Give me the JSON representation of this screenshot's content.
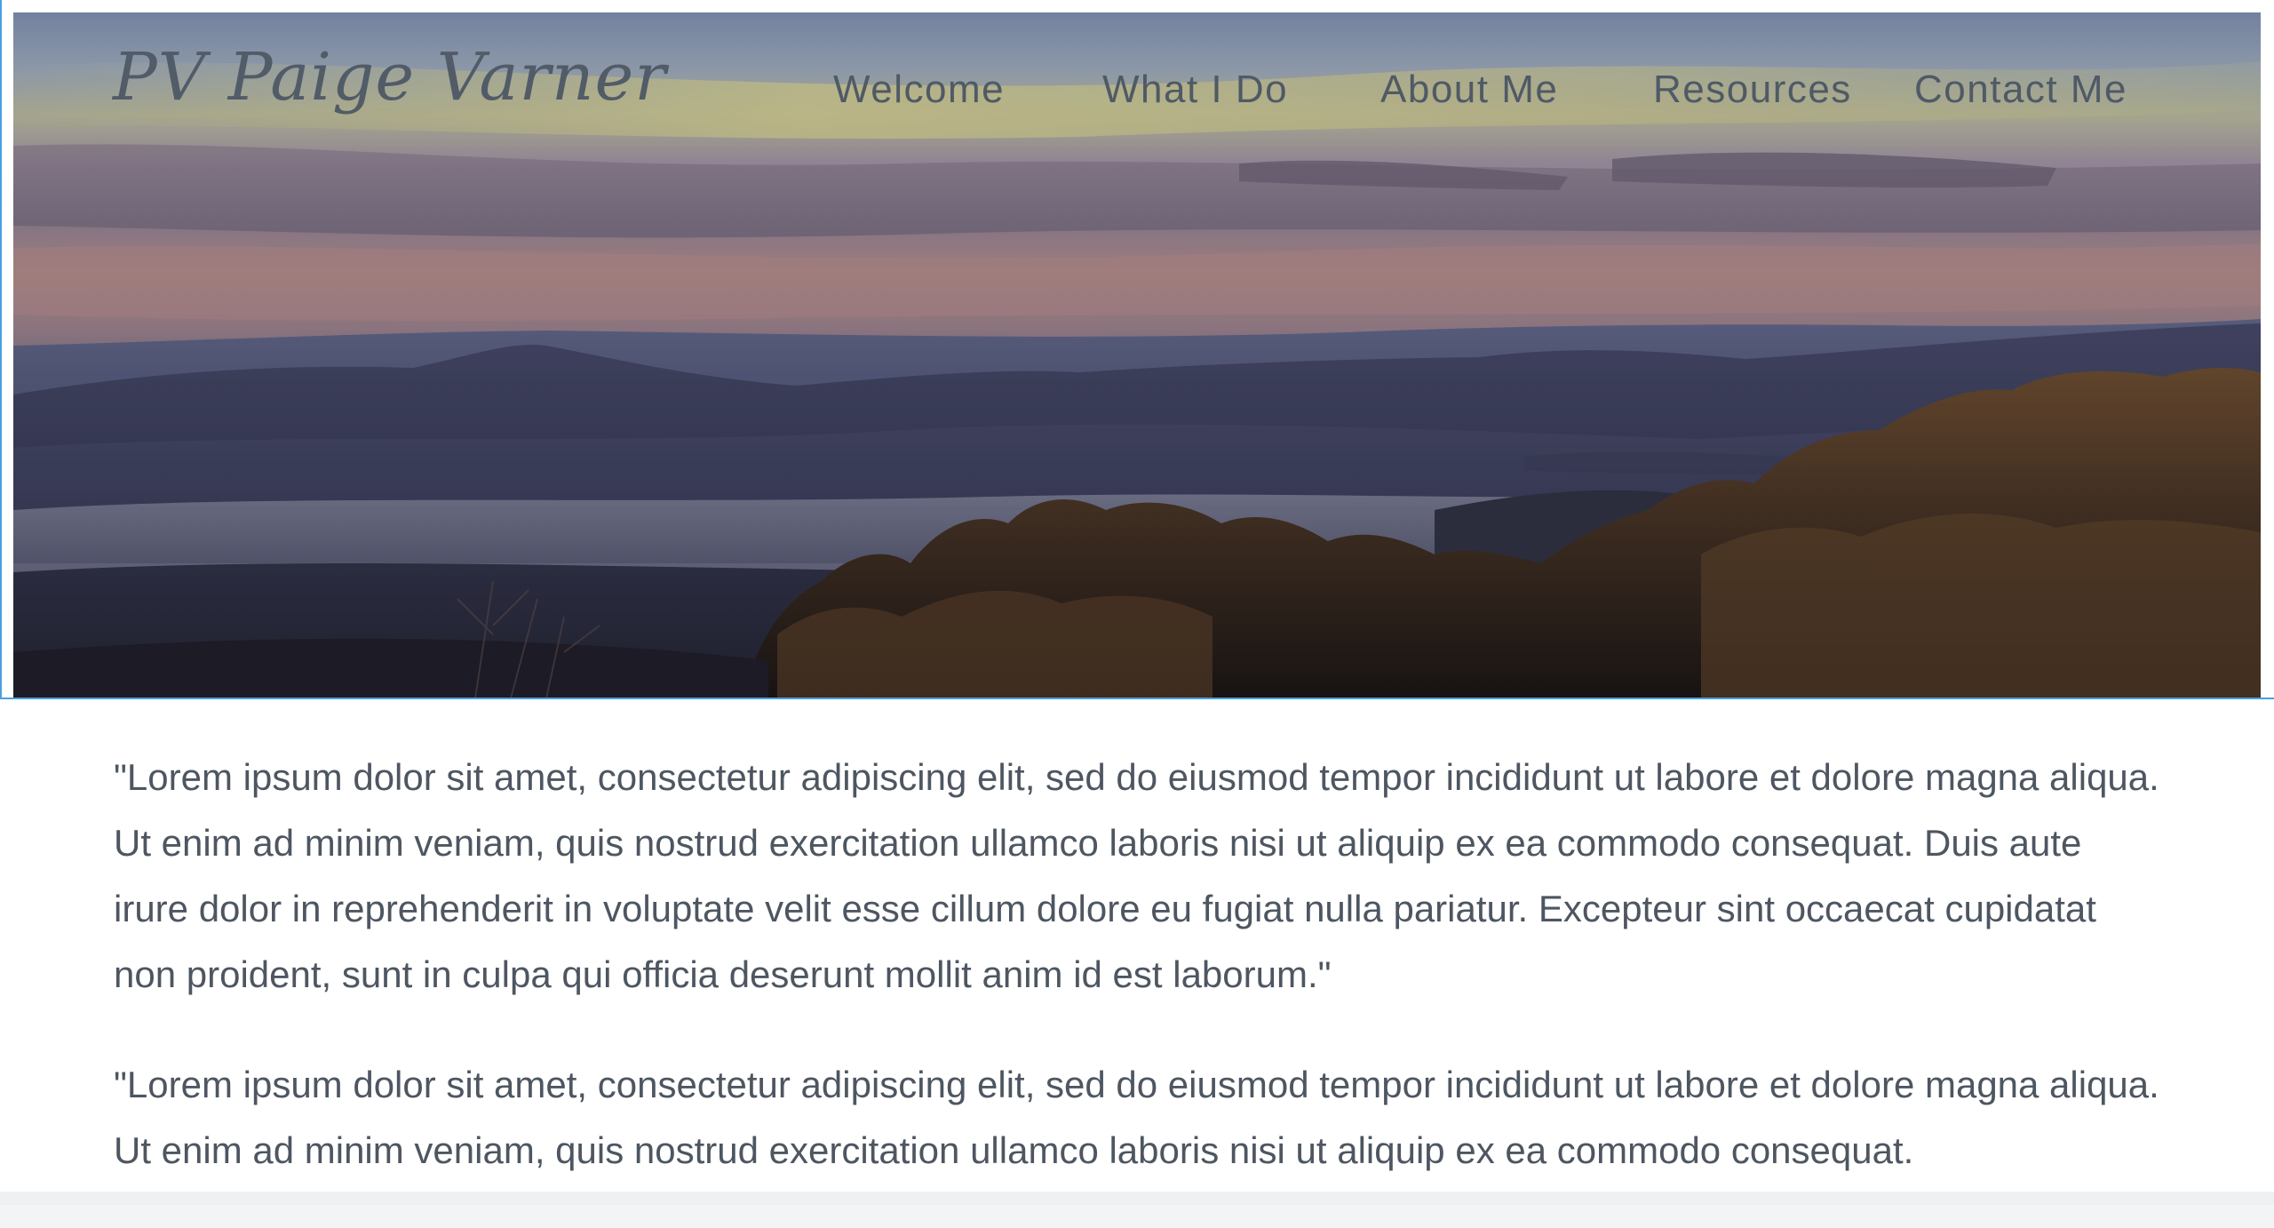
{
  "site": {
    "logo_text": "PV Paige Varner"
  },
  "nav": {
    "items": [
      {
        "label": "Welcome"
      },
      {
        "label": "What I Do"
      },
      {
        "label": "About Me"
      },
      {
        "label": "Resources"
      },
      {
        "label": "Contact Me"
      }
    ]
  },
  "hero": {
    "image_subject": "mountain-sunrise-landscape"
  },
  "content": {
    "paragraphs": [
      "\"Lorem ipsum dolor sit amet, consectetur adipiscing elit, sed do eiusmod tempor incididunt ut labore et dolore magna aliqua. Ut enim ad minim veniam, quis nostrud exercitation ullamco laboris nisi ut aliquip ex ea commodo consequat. Duis aute irure dolor in reprehenderit in voluptate velit esse cillum dolore eu fugiat nulla pariatur. Excepteur sint occaecat cupidatat non proident, sunt in culpa qui officia deserunt mollit anim id est laborum.\"",
      "\"Lorem ipsum dolor sit amet, consectetur adipiscing elit, sed do eiusmod tempor incididunt ut labore et dolore magna aliqua. Ut enim ad minim veniam, quis nostrud exercitation ullamco laboris nisi ut aliquip ex ea commodo consequat."
    ]
  },
  "colors": {
    "text": "#4d5661",
    "nav_text": "#4f5a66",
    "frame_accent": "#4a9fe0"
  }
}
